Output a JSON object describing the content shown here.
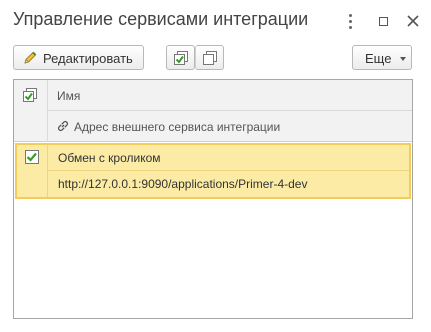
{
  "window": {
    "title": "Управление сервисами интеграции"
  },
  "titlebar": {
    "more_icon": "vertical-dots-icon",
    "maximize_icon": "maximize-icon",
    "close_icon": "close-icon"
  },
  "toolbar": {
    "edit_label": "Редактировать",
    "edit_icon": "pencil-icon",
    "check_all_icon": "check-all-icon",
    "uncheck_all_icon": "uncheck-all-icon",
    "more_label": "Еще"
  },
  "table": {
    "columns": {
      "name": "Имя",
      "address": "Адрес внешнего сервиса интеграции"
    },
    "rows": [
      {
        "checked": true,
        "name": "Обмен с кроликом",
        "address": "http://127.0.0.1:9090/applications/Primer-4-dev"
      }
    ]
  },
  "colors": {
    "selected_row_bg": "#fbeba4",
    "selected_row_border": "#f4cc59",
    "check_green": "#3a9a2a",
    "header_bg": "#f2f2f2"
  }
}
